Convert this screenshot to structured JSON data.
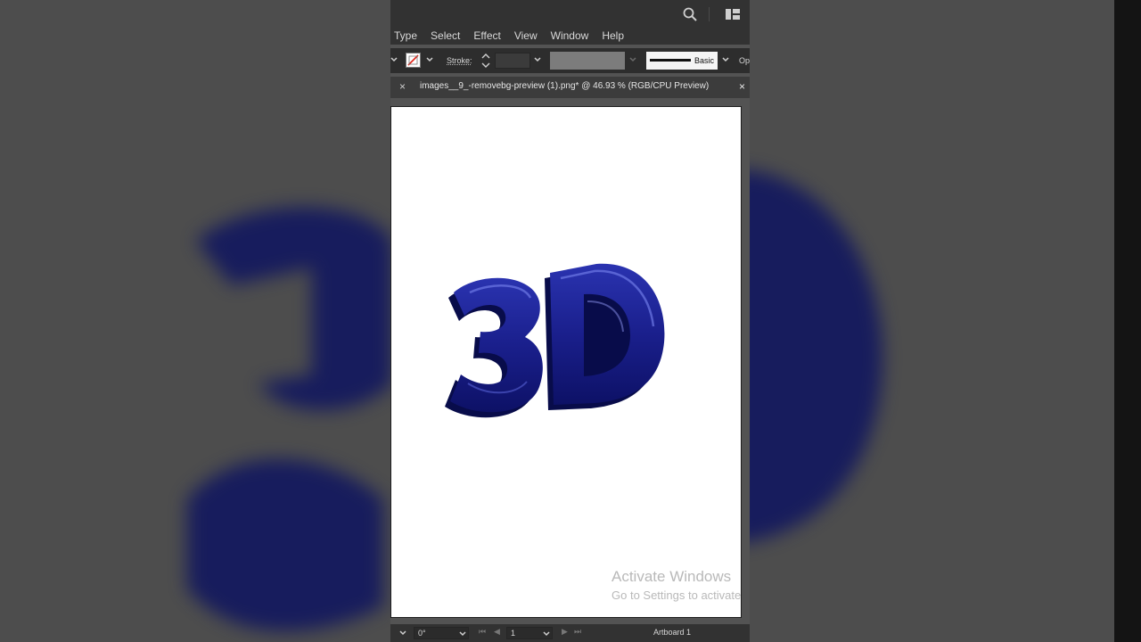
{
  "menubar": {
    "items": [
      "Type",
      "Select",
      "Effect",
      "View",
      "Window",
      "Help"
    ]
  },
  "controlbar": {
    "stroke_label": "Stroke:",
    "brush_label": "Basic",
    "opacity_label": "Op"
  },
  "document_tab": {
    "title": "images__9_-removebg-preview (1).png* @ 46.93 % (RGB/CPU Preview)",
    "close_glyph": "×"
  },
  "artwork": {
    "text": "3D",
    "fill_color": "#1a1f8c",
    "dark_color": "#0a0f55"
  },
  "watermark": {
    "title": "Activate Windows",
    "subtitle": "Go to Settings to activate"
  },
  "statusbar": {
    "rotation": "0°",
    "artboard_number": "1",
    "artboard_name": "Artboard 1"
  },
  "colors": {
    "app_bg": "#535353",
    "panel_dark": "#323232",
    "accent_blue": "#1a1f8c"
  }
}
